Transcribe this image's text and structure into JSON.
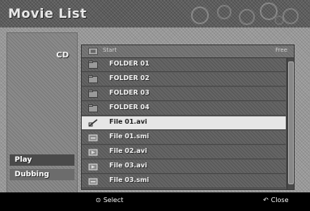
{
  "window": {
    "title": "Movie List"
  },
  "source": {
    "label": "CD"
  },
  "side_menu": [
    {
      "label": "Play"
    },
    {
      "label": "Dubbing"
    }
  ],
  "list_header": {
    "start_label": "Start",
    "free_label": "Free"
  },
  "files": [
    {
      "label": "FOLDER 01",
      "icon": "folder-icon",
      "selected": false
    },
    {
      "label": "FOLDER 02",
      "icon": "folder-icon",
      "selected": false
    },
    {
      "label": "FOLDER 03",
      "icon": "folder-icon",
      "selected": false
    },
    {
      "label": "FOLDER 04",
      "icon": "folder-icon",
      "selected": false
    },
    {
      "label": "File 01.avi",
      "icon": "movie-file-icon",
      "selected": true
    },
    {
      "label": "File 01.smi",
      "icon": "subtitle-file-icon",
      "selected": false
    },
    {
      "label": "File 02.avi",
      "icon": "movie-file-icon",
      "selected": false
    },
    {
      "label": "File 03.avi",
      "icon": "movie-file-icon",
      "selected": false
    },
    {
      "label": "File 03.smi",
      "icon": "subtitle-file-icon",
      "selected": false
    }
  ],
  "footer": {
    "select_label": "Select",
    "close_label": "Close",
    "select_icon": "enter-icon",
    "close_icon": "return-icon"
  },
  "colors": {
    "selected_row": "#e6e6e6",
    "play_button": "#4a4a4a",
    "dubbing_button": "#6c6c6c",
    "footer_bg": "#000000"
  }
}
